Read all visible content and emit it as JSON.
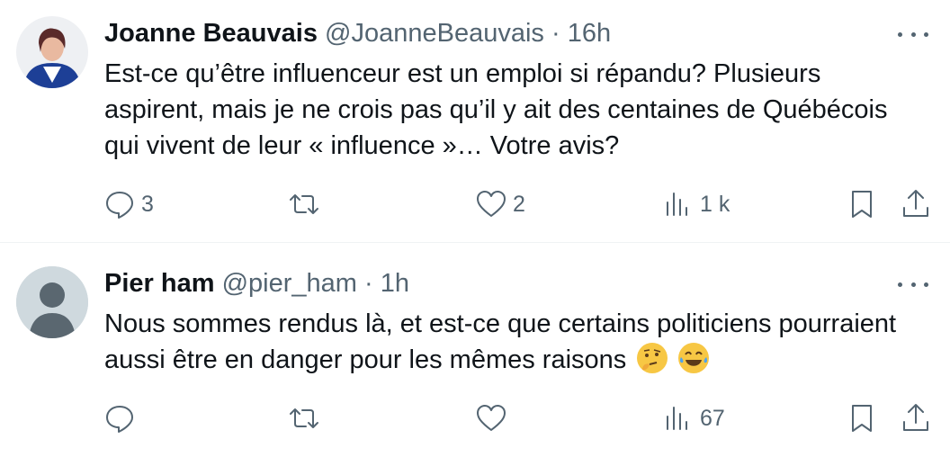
{
  "tweets": [
    {
      "name": "Joanne Beauvais",
      "handle": "@JoanneBeauvais",
      "separator": "·",
      "time": "16h",
      "text": "Est-ce qu’être influenceur est un emploi si répandu? Plusieurs aspirent, mais je ne crois pas qu’il y ait des centaines de Québécois qui vivent de leur « influence »… Votre avis?",
      "emojis": [],
      "stats": {
        "replies": "3",
        "retweets": "",
        "likes": "2",
        "views": "1 k"
      }
    },
    {
      "name": "Pier ham",
      "handle": "@pier_ham",
      "separator": "·",
      "time": "1h",
      "text": "Nous sommes rendus là, et est-ce que certains politiciens pourraient aussi être en danger pour les mêmes raisons",
      "emojis": [
        "thinking-face",
        "tears-of-joy"
      ],
      "stats": {
        "replies": "",
        "retweets": "",
        "likes": "",
        "views": "67"
      }
    }
  ],
  "icons": [
    "reply-icon",
    "retweet-icon",
    "like-icon",
    "views-icon",
    "bookmark-icon",
    "share-icon",
    "more-icon"
  ],
  "colors": {
    "text": "#0f1419",
    "muted": "#536471",
    "divider": "#eff3f4",
    "avatar_default": "#cfd9de",
    "avatar_bg": "#2a4f9b"
  }
}
